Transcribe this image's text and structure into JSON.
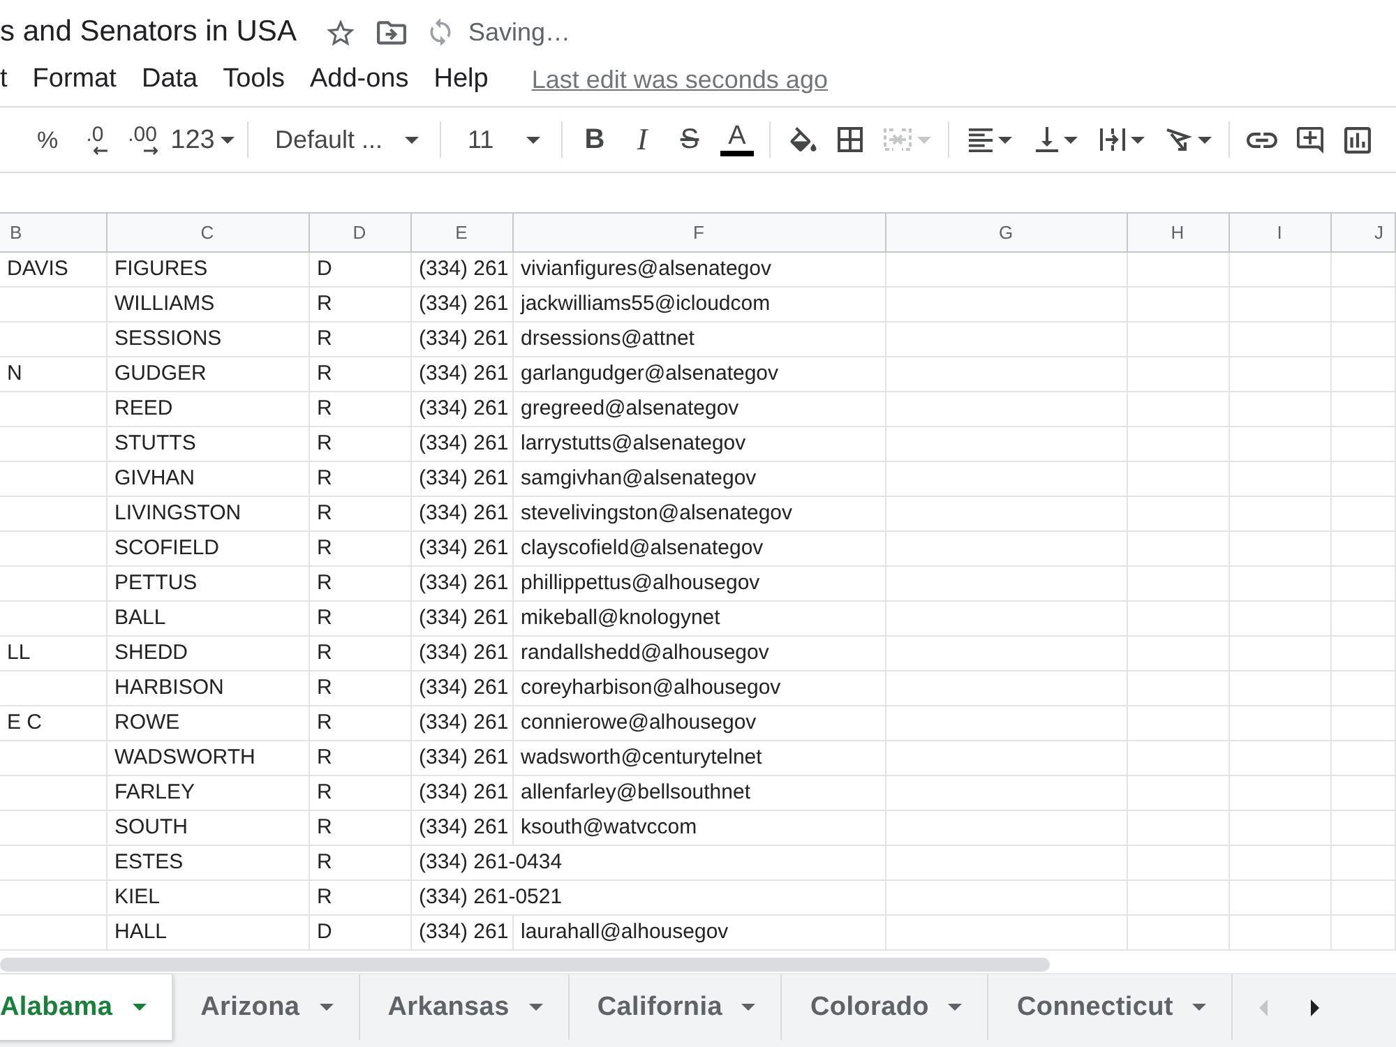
{
  "header": {
    "title": "s and Senators in USA",
    "starred": false,
    "save_status": "Saving…"
  },
  "menu": {
    "items": [
      "t",
      "Format",
      "Data",
      "Tools",
      "Add-ons",
      "Help"
    ],
    "last_edit": "Last edit was seconds ago"
  },
  "toolbar": [
    [
      {
        "kind": "percent",
        "label": "%",
        "dropdown": false,
        "disabled": false
      },
      {
        "kind": "decimal_decrease",
        "label": ".0",
        "dropdown": false,
        "disabled": false
      },
      {
        "kind": "decimal_increase",
        "label": ".00",
        "dropdown": false,
        "disabled": false
      },
      {
        "kind": "number_format",
        "label": "123",
        "dropdown": true,
        "disabled": false
      }
    ],
    [
      {
        "kind": "font_family",
        "label": "Default ...",
        "dropdown": true,
        "disabled": false
      }
    ],
    [
      {
        "kind": "font_size",
        "label": "11",
        "dropdown": true,
        "disabled": false
      }
    ],
    [
      {
        "kind": "bold",
        "label": "B",
        "dropdown": false,
        "disabled": false
      },
      {
        "kind": "italic",
        "label": "I",
        "dropdown": false,
        "disabled": false
      },
      {
        "kind": "strikethrough",
        "label": "S",
        "dropdown": false,
        "disabled": false
      },
      {
        "kind": "text_color",
        "label": "A",
        "dropdown": false,
        "disabled": false
      }
    ],
    [
      {
        "kind": "fill_color",
        "dropdown": false,
        "disabled": false
      },
      {
        "kind": "borders",
        "dropdown": false,
        "disabled": false
      },
      {
        "kind": "merge",
        "dropdown": true,
        "disabled": true
      }
    ],
    [
      {
        "kind": "horizontal_align",
        "dropdown": true,
        "disabled": false
      },
      {
        "kind": "vertical_align",
        "dropdown": true,
        "disabled": false
      },
      {
        "kind": "wrap",
        "dropdown": true,
        "disabled": false
      },
      {
        "kind": "rotate",
        "dropdown": true,
        "disabled": false
      }
    ],
    [
      {
        "kind": "link",
        "dropdown": false,
        "disabled": false
      },
      {
        "kind": "comment",
        "dropdown": false,
        "disabled": false
      },
      {
        "kind": "chart",
        "dropdown": false,
        "disabled": false
      }
    ]
  ],
  "sheet": {
    "columns": [
      "B",
      "C",
      "D",
      "E",
      "F",
      "G",
      "H",
      "I",
      "J"
    ],
    "rows": [
      {
        "b": "DAVIS",
        "c": "FIGURES",
        "d": "D",
        "e": "(334) 261",
        "f": "vivianfigures@alsenategov"
      },
      {
        "c": "WILLIAMS",
        "d": "R",
        "e": "(334) 261",
        "f": "jackwilliams55@icloudcom"
      },
      {
        "c": "SESSIONS",
        "d": "R",
        "e": "(334) 261",
        "f": "drsessions@attnet"
      },
      {
        "b": "N",
        "c": "GUDGER",
        "d": "R",
        "e": "(334) 261",
        "f": "garlangudger@alsenategov"
      },
      {
        "c": "REED",
        "d": "R",
        "e": "(334) 261",
        "f": "gregreed@alsenategov"
      },
      {
        "c": "STUTTS",
        "d": "R",
        "e": "(334) 261",
        "f": "larrystutts@alsenategov"
      },
      {
        "c": "GIVHAN",
        "d": "R",
        "e": "(334) 261",
        "f": "samgivhan@alsenategov"
      },
      {
        "c": "LIVINGSTON",
        "d": "R",
        "e": "(334) 261",
        "f": "stevelivingston@alsenategov"
      },
      {
        "c": "SCOFIELD",
        "d": "R",
        "e": "(334) 261",
        "f": "clayscofield@alsenategov"
      },
      {
        "c": "PETTUS",
        "d": "R",
        "e": "(334) 261",
        "f": "phillippettus@alhousegov"
      },
      {
        "c": "BALL",
        "d": "R",
        "e": "(334) 261",
        "f": "mikeball@knologynet"
      },
      {
        "b": "LL",
        "c": "SHEDD",
        "d": "R",
        "e": "(334) 261",
        "f": "randallshedd@alhousegov"
      },
      {
        "c": "HARBISON",
        "d": "R",
        "e": "(334) 261",
        "f": "coreyharbison@alhousegov"
      },
      {
        "b": "E C",
        "c": "ROWE",
        "d": "R",
        "e": "(334) 261",
        "f": "connierowe@alhousegov"
      },
      {
        "c": "WADSWORTH",
        "d": "R",
        "e": "(334) 261",
        "f": "wadsworth@centurytelnet"
      },
      {
        "c": "FARLEY",
        "d": "R",
        "e": "(334) 261",
        "f": "allenfarley@bellsouthnet"
      },
      {
        "c": "SOUTH",
        "d": "R",
        "e": "(334) 261",
        "f": "ksouth@watvccom"
      },
      {
        "c": "ESTES",
        "d": "R",
        "e": "(334) 261-0434"
      },
      {
        "c": "KIEL",
        "d": "R",
        "e": "(334) 261-0521"
      },
      {
        "c": "HALL",
        "d": "D",
        "e": "(334) 261",
        "f": "laurahall@alhousegov"
      }
    ]
  },
  "sheet_tabs": [
    {
      "label": "Alabama",
      "selected": true
    },
    {
      "label": "Arizona",
      "selected": false
    },
    {
      "label": "Arkansas",
      "selected": false
    },
    {
      "label": "California",
      "selected": false
    },
    {
      "label": "Colorado",
      "selected": false
    },
    {
      "label": "Connecticut",
      "selected": false
    }
  ],
  "tab_scroll": [
    {
      "kind": "previous",
      "disabled": true
    },
    {
      "kind": "next",
      "disabled": false
    }
  ]
}
